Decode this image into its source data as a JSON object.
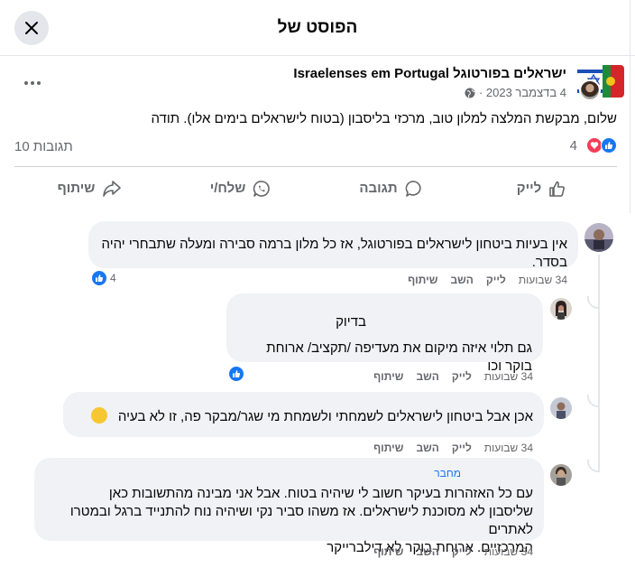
{
  "modal": {
    "title": "הפוסט של"
  },
  "post": {
    "group_name": "ישראלים בפורטוגל Israelenses em Portugal",
    "date": "4 בדצמבר 2023 ·",
    "body": "שלום, מבקשת המלצה למלון טוב, מרכזי בליסבון (בטוח לישראלים בימים אלו). תודה",
    "reaction_count": "4",
    "comments_count": "10 תגובות"
  },
  "actions": {
    "like": "לייק",
    "comment": "תגובה",
    "send": "שלח/י",
    "share": "שיתוף"
  },
  "comments": [
    {
      "text": "אין בעיות ביטחון לישראלים בפורטוגל, אז כל מלון ברמה סבירה ומעלה שתבחרי יהיה בסדר.",
      "time": "34 שבועות",
      "like": "לייק",
      "reply": "השב",
      "share": "שיתוף",
      "reactions": "4"
    },
    {
      "line1": "בדיוק",
      "line2": "גם תלוי איזה מיקום את מעדיפה /תקציב/ ארוחת בוקר וכו",
      "time": "34 שבועות",
      "like": "לייק",
      "reply": "השב",
      "share": "שיתוף"
    },
    {
      "text": "אכן אבל ביטחון לישראלים לשמחתי ולשמחת מי שגר/מבקר פה, זו לא בעיה",
      "emoji": "😊",
      "time": "34 שבועות",
      "like": "לייק",
      "reply": "השב",
      "share": "שיתוף"
    },
    {
      "author_tag": "מחבר",
      "line1": "עם כל האזהרות בעיקר חשוב לי שיהיה בטוח. אבל אני מבינה מהתשובות כאן",
      "line2": "שליסבון לא מסוכנת לישראלים. אז משהו סביר נקי ושיהיה נוח להתנייד ברגל ובמטרו לאתרים",
      "line3": "המרכזיים. ארוחת בוקר לא דילברייקר",
      "time": "34 שבועות",
      "like": "לייק",
      "reply": "השב",
      "share": "שיתוף"
    }
  ],
  "icons": {
    "close": "close-icon",
    "more": "more-horizontal-icon",
    "globe": "globe-icon",
    "like": "thumbs-up-icon",
    "comment": "speech-bubble-icon",
    "send": "whatsapp-icon",
    "share": "share-arrow-icon"
  },
  "colors": {
    "accent": "#1877f2",
    "love": "#f33e58",
    "bubble": "#f0f2f5",
    "muted": "#65676b"
  }
}
